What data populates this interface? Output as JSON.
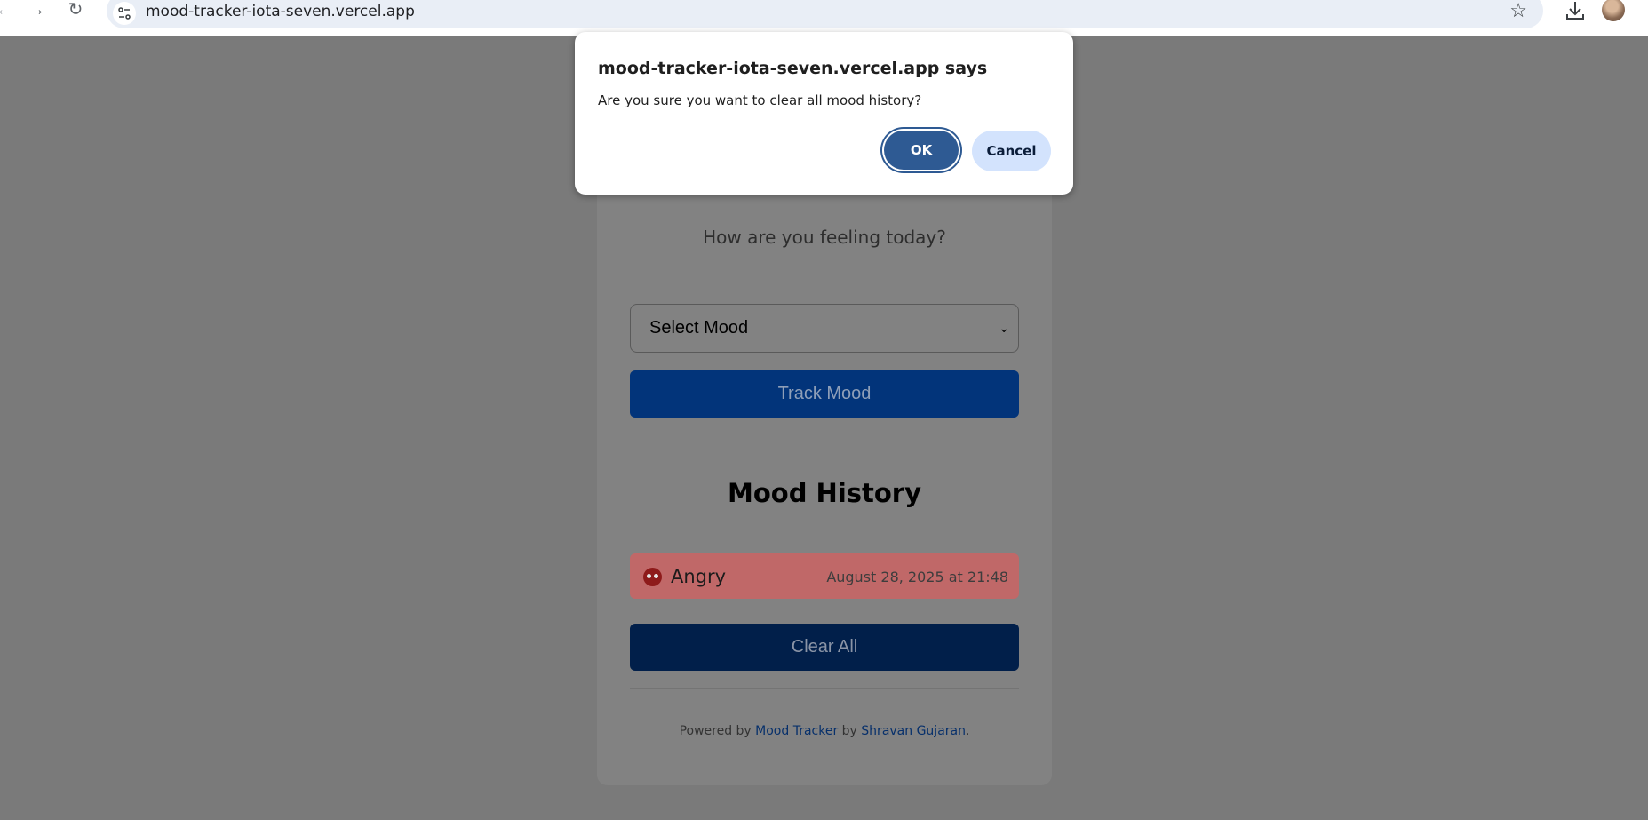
{
  "browser": {
    "url": "mood-tracker-iota-seven.vercel.app",
    "back_icon": "arrow-left-icon",
    "forward_icon": "arrow-right-icon",
    "reload_icon": "reload-icon",
    "bookmark_icon": "star-icon",
    "download_icon": "download-icon"
  },
  "app": {
    "prompt": "How are you feeling today?",
    "select_value": "Select Mood",
    "track_button": "Track Mood",
    "history_title": "Mood History",
    "history": [
      {
        "mood": "Angry",
        "time": "August 28, 2025 at 21:48",
        "color": "#c06868"
      }
    ],
    "clear_button": "Clear All",
    "footer": {
      "prefix": "Powered by ",
      "app_link": "Mood Tracker",
      "middle": " by ",
      "author_link": "Shravan Gujaran",
      "suffix": "."
    }
  },
  "dialog": {
    "title": "mood-tracker-iota-seven.vercel.app says",
    "message": "Are you sure you want to clear all mood history?",
    "ok_label": "OK",
    "cancel_label": "Cancel"
  },
  "colors": {
    "primary": "#0056b3",
    "dialog_ok": "#2e5a93",
    "dialog_cancel": "#d3e3fd"
  }
}
